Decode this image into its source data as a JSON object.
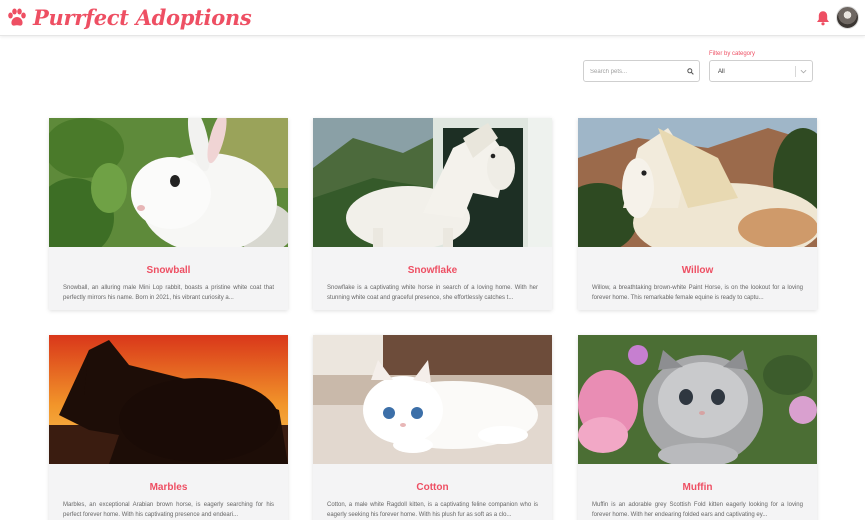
{
  "header": {
    "brand": "Purrfect Adoptions",
    "logo_icon": "paw-icon",
    "notification_icon": "bell-icon",
    "accent_color": "#ee4f63"
  },
  "filters": {
    "search_placeholder": "Search pets...",
    "search_value": "",
    "category_label": "Filter by category",
    "category_selected": "All"
  },
  "pets": [
    {
      "name": "Snowball",
      "description": "Snowball, an alluring male Mini Lop rabbit, boasts a pristine white coat that perfectly mirrors his name. Born in 2021, his vibrant curiosity a..."
    },
    {
      "name": "Snowflake",
      "description": "Snowflake is a captivating white horse in search of a loving home. With her stunning white coat and graceful presence, she effortlessly catches t..."
    },
    {
      "name": "Willow",
      "description": "Willow, a breathtaking brown-white Paint Horse, is on the lookout for a loving forever home. This remarkable female equine is ready to captu..."
    },
    {
      "name": "Marbles",
      "description": "Marbles, an exceptional Arabian brown horse, is eagerly searching for his perfect forever home. With his captivating presence and endeari..."
    },
    {
      "name": "Cotton",
      "description": "Cotton, a male white Ragdoll kitten, is a captivating feline companion who is eagerly seeking his forever home. With his plush fur as soft as a clo..."
    },
    {
      "name": "Muffin",
      "description": "Muffin is an adorable grey Scottish Fold kitten eagerly looking for a loving forever home. With her endearing folded ears and captivating ey..."
    }
  ]
}
